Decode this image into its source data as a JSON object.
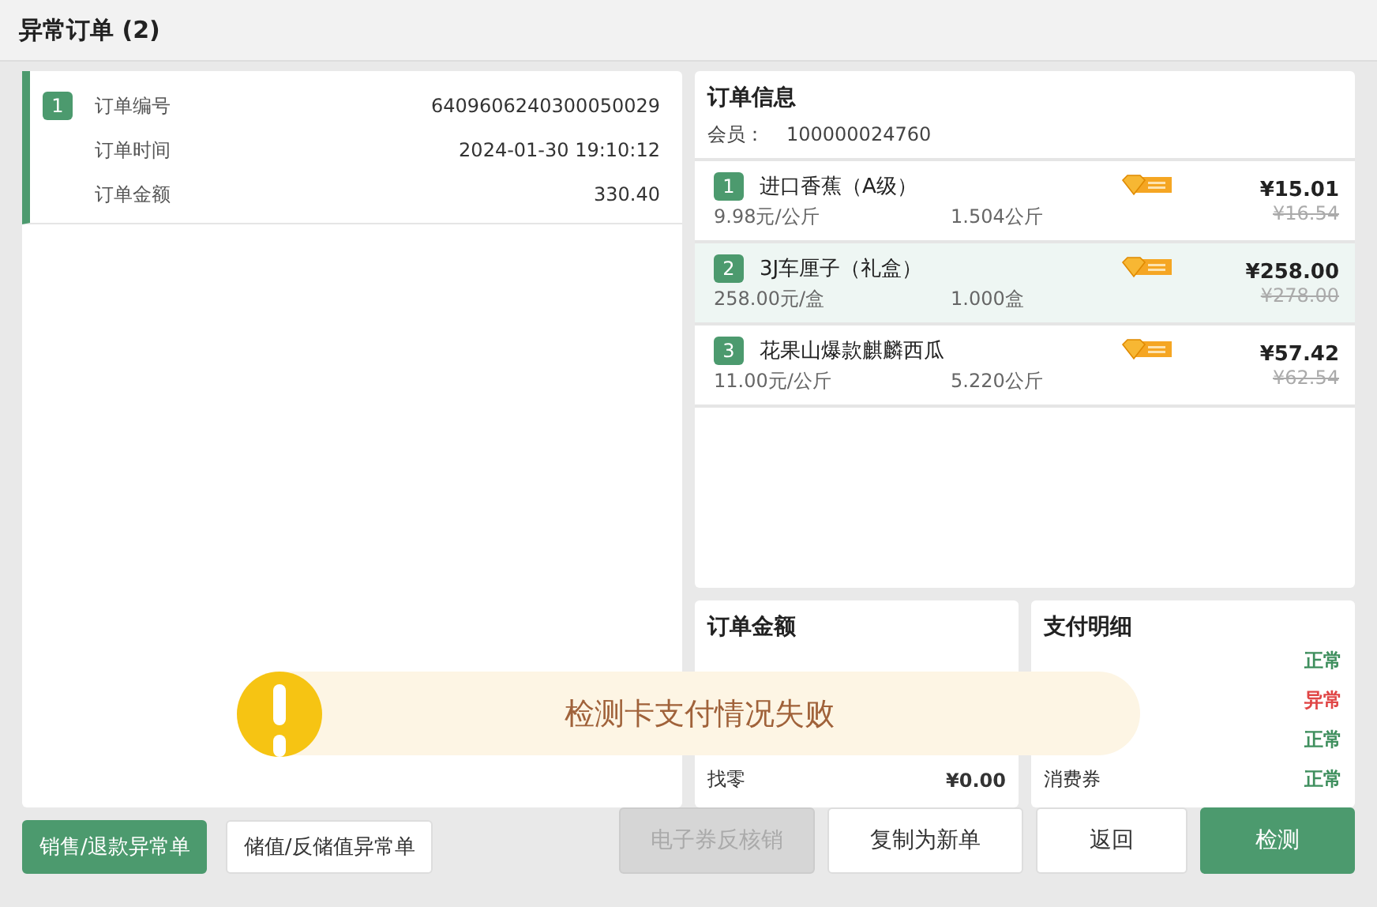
{
  "window": {
    "title": "异常订单 (2)"
  },
  "orders": [
    {
      "index": "1",
      "selected": true,
      "fields": [
        {
          "label": "订单编号",
          "value": "6409606240300050029"
        },
        {
          "label": "订单时间",
          "value": "2024-01-30 19:10:12"
        },
        {
          "label": "订单金额",
          "value": "330.40"
        }
      ]
    }
  ],
  "order_info": {
    "title": "订单信息",
    "member_label": "会员：",
    "member_id": "100000024760",
    "items": [
      {
        "index": "1",
        "name": "进口香蕉（A级）",
        "unit_price": "9.98元/公斤",
        "quantity": "1.504公斤",
        "price": "¥15.01",
        "original_price": "¥16.54",
        "selected": false
      },
      {
        "index": "2",
        "name": "3J车厘子（礼盒）",
        "unit_price": "258.00元/盒",
        "quantity": "1.000盒",
        "price": "¥258.00",
        "original_price": "¥278.00",
        "selected": true
      },
      {
        "index": "3",
        "name": "花果山爆款麒麟西瓜",
        "unit_price": "11.00元/公斤",
        "quantity": "5.220公斤",
        "price": "¥57.42",
        "original_price": "¥62.54",
        "selected": false
      }
    ]
  },
  "order_amount": {
    "title": "订单金额",
    "rows": [
      {
        "label": "找零",
        "value": "¥0.00"
      }
    ]
  },
  "payment_details": {
    "title": "支付明细",
    "rows": [
      {
        "status": "正常",
        "kind": "ok"
      },
      {
        "status": "异常",
        "kind": "error"
      },
      {
        "status": "正常",
        "kind": "ok"
      },
      {
        "label": "消费券",
        "status": "正常",
        "kind": "ok"
      }
    ]
  },
  "toast": {
    "message": "检测卡支付情况失败"
  },
  "buttons_left": [
    {
      "label": "销售/退款异常单",
      "selected": true
    },
    {
      "label": "储值/反储值异常单",
      "selected": false
    }
  ],
  "buttons_right": [
    {
      "label": "电子券反核销",
      "kind": "default",
      "disabled": true
    },
    {
      "label": "复制为新单",
      "kind": "default",
      "disabled": false
    },
    {
      "label": "返回",
      "kind": "default",
      "disabled": false
    },
    {
      "label": "检测",
      "kind": "primary",
      "disabled": false
    }
  ]
}
